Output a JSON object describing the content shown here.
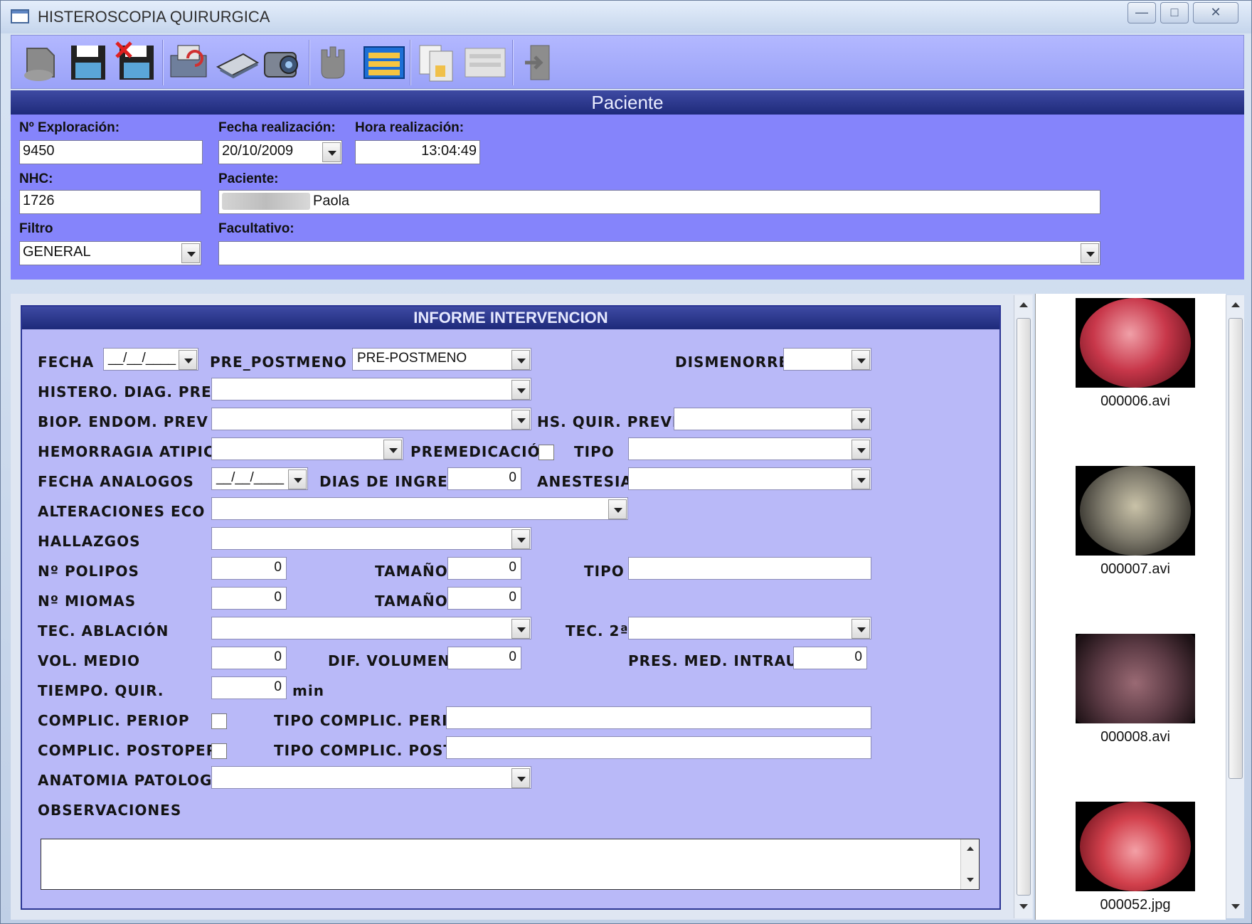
{
  "window": {
    "title": "HISTEROSCOPIA QUIRURGICA"
  },
  "toolbar": {
    "buttons": [
      "back-icon",
      "save-icon",
      "delete-save-icon",
      "refresh-icon",
      "send-icon",
      "camera-icon",
      "hand-icon",
      "report-icon",
      "document-icon",
      "list-icon",
      "exit-icon"
    ]
  },
  "patient": {
    "header": "Paciente",
    "exploration_label": "Nº Exploración:",
    "exploration_value": "9450",
    "date_label": "Fecha realización:",
    "date_value": "20/10/2009",
    "time_label": "Hora realización:",
    "time_value": "13:04:49",
    "nhc_label": "NHC:",
    "nhc_value": "1726",
    "patient_label": "Paciente:",
    "patient_value": "Paola",
    "filter_label": "Filtro",
    "filter_value": "GENERAL",
    "doctor_label": "Facultativo:",
    "doctor_value": ""
  },
  "form": {
    "header": "INFORME INTERVENCION",
    "fecha_label": "FECHA",
    "fecha_value": "__/__/____",
    "pre_postmeno_label": "PRE_POSTMENO",
    "pre_postmeno_value": "PRE-POSTMENO",
    "dismenorrea_label": "DISMENORREA",
    "dismenorrea_value": "",
    "histero_label": "HISTERO. DIAG. PREV",
    "histero_value": "",
    "biop_label": "BIOP. ENDOM. PREV",
    "biop_value": "",
    "hs_quir_label": "HS. QUIR. PREVIA",
    "hs_quir_value": "",
    "hemorragia_label": "HEMORRAGIA ATIPICA",
    "hemorragia_value": "",
    "premedicacion_label": "PREMEDICACIÓN",
    "tipo_label": "TIPO",
    "tipo_value": "",
    "fecha_analogos_label": "FECHA ANALOGOS",
    "fecha_analogos_value": "__/__/____",
    "dias_ingreso_label": "DIAS DE INGRESO",
    "dias_ingreso_value": "0",
    "anestesia_label": "ANESTESIA",
    "anestesia_value": "",
    "alteraciones_label": "ALTERACIONES ECO",
    "alteraciones_value": "",
    "hallazgos_label": "HALLAZGOS",
    "hallazgos_value": "",
    "polipos_label": "Nº POLIPOS",
    "polipos_value": "0",
    "tamano_label": "TAMAÑO",
    "tamano1_value": "0",
    "tipo2_label": "TIPO",
    "tipo2_value": "",
    "miomas_label": "Nº MIOMAS",
    "miomas_value": "0",
    "tamano2_value": "0",
    "tec_ablacion_label": "TEC. ABLACIÓN",
    "tec_ablacion_value": "",
    "tec2_label": "TEC. 2ª",
    "tec2_value": "",
    "vol_medio_label": "VOL. MEDIO",
    "vol_medio_value": "0",
    "dif_volumen_label": "DIF. VOLUMEN",
    "dif_volumen_value": "0",
    "pres_med_label": "PRES. MED. INTRAU",
    "pres_med_value": "0",
    "tiempo_label": "TIEMPO. QUIR.",
    "tiempo_value": "0",
    "tiempo_unit": "min",
    "complic_periop_label": "COMPLIC. PERIOP",
    "tipo_complic_periop_label": "TIPO COMPLIC. PERIOP",
    "tipo_complic_periop_value": "",
    "complic_postoper_label": "COMPLIC. POSTOPER",
    "tipo_complic_post_label": "TIPO COMPLIC. POST",
    "tipo_complic_post_value": "",
    "anatomia_label": "ANATOMIA PATOLOGICA",
    "anatomia_value": "",
    "observaciones_label": "OBSERVACIONES",
    "observaciones_value": ""
  },
  "media": {
    "items": [
      {
        "name": "000006.avi",
        "color": "#c8374a"
      },
      {
        "name": "000007.avi",
        "color": "#7e7a6c"
      },
      {
        "name": "000008.avi",
        "color": "#5b3a44"
      },
      {
        "name": "000052.jpg",
        "color": "#d2404c"
      }
    ]
  },
  "colors": {
    "panel": "#8584fb",
    "form_bg": "#b9b9f8",
    "header": "#1e2a7a"
  }
}
